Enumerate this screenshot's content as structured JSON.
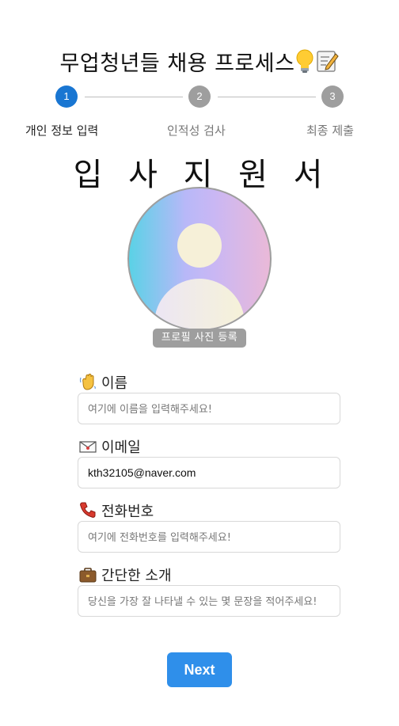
{
  "header": {
    "title": "무업청년들 채용 프로세스"
  },
  "stepper": {
    "steps": [
      {
        "number": "1",
        "label": "개인 정보 입력",
        "active": true
      },
      {
        "number": "2",
        "label": "인적성 검사",
        "active": false
      },
      {
        "number": "3",
        "label": "최종 제출",
        "active": false
      }
    ]
  },
  "form": {
    "heading": "입 사 지 원 서",
    "profile_button": "프로필 사진 등록",
    "fields": {
      "name": {
        "label": "이름",
        "icon": "waving-hand-icon",
        "value": "",
        "placeholder": "여기에 이름을 입력해주세요!"
      },
      "email": {
        "label": "이메일",
        "icon": "envelope-icon",
        "value": "kth32105@naver.com",
        "placeholder": ""
      },
      "phone": {
        "label": "전화번호",
        "icon": "telephone-icon",
        "value": "",
        "placeholder": "여기에 전화번호를 입력해주세요!"
      },
      "intro": {
        "label": "간단한 소개",
        "icon": "briefcase-icon",
        "value": "",
        "placeholder": "당신을 가장 잘 나타낼 수 있는 몇 문장을 적어주세요!"
      }
    },
    "next_label": "Next"
  },
  "colors": {
    "accent": "#1976d2",
    "button": "#2f8fea",
    "inactive": "#9e9e9e"
  }
}
